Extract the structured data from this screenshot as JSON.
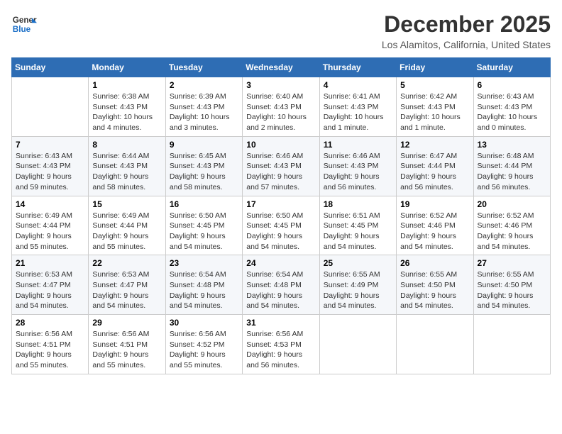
{
  "header": {
    "logo_line1": "General",
    "logo_line2": "Blue",
    "month": "December 2025",
    "location": "Los Alamitos, California, United States"
  },
  "weekdays": [
    "Sunday",
    "Monday",
    "Tuesday",
    "Wednesday",
    "Thursday",
    "Friday",
    "Saturday"
  ],
  "weeks": [
    [
      {
        "day": "",
        "info": ""
      },
      {
        "day": "1",
        "info": "Sunrise: 6:38 AM\nSunset: 4:43 PM\nDaylight: 10 hours\nand 4 minutes."
      },
      {
        "day": "2",
        "info": "Sunrise: 6:39 AM\nSunset: 4:43 PM\nDaylight: 10 hours\nand 3 minutes."
      },
      {
        "day": "3",
        "info": "Sunrise: 6:40 AM\nSunset: 4:43 PM\nDaylight: 10 hours\nand 2 minutes."
      },
      {
        "day": "4",
        "info": "Sunrise: 6:41 AM\nSunset: 4:43 PM\nDaylight: 10 hours\nand 1 minute."
      },
      {
        "day": "5",
        "info": "Sunrise: 6:42 AM\nSunset: 4:43 PM\nDaylight: 10 hours\nand 1 minute."
      },
      {
        "day": "6",
        "info": "Sunrise: 6:43 AM\nSunset: 4:43 PM\nDaylight: 10 hours\nand 0 minutes."
      }
    ],
    [
      {
        "day": "7",
        "info": "Sunrise: 6:43 AM\nSunset: 4:43 PM\nDaylight: 9 hours\nand 59 minutes."
      },
      {
        "day": "8",
        "info": "Sunrise: 6:44 AM\nSunset: 4:43 PM\nDaylight: 9 hours\nand 58 minutes."
      },
      {
        "day": "9",
        "info": "Sunrise: 6:45 AM\nSunset: 4:43 PM\nDaylight: 9 hours\nand 58 minutes."
      },
      {
        "day": "10",
        "info": "Sunrise: 6:46 AM\nSunset: 4:43 PM\nDaylight: 9 hours\nand 57 minutes."
      },
      {
        "day": "11",
        "info": "Sunrise: 6:46 AM\nSunset: 4:43 PM\nDaylight: 9 hours\nand 56 minutes."
      },
      {
        "day": "12",
        "info": "Sunrise: 6:47 AM\nSunset: 4:44 PM\nDaylight: 9 hours\nand 56 minutes."
      },
      {
        "day": "13",
        "info": "Sunrise: 6:48 AM\nSunset: 4:44 PM\nDaylight: 9 hours\nand 56 minutes."
      }
    ],
    [
      {
        "day": "14",
        "info": "Sunrise: 6:49 AM\nSunset: 4:44 PM\nDaylight: 9 hours\nand 55 minutes."
      },
      {
        "day": "15",
        "info": "Sunrise: 6:49 AM\nSunset: 4:44 PM\nDaylight: 9 hours\nand 55 minutes."
      },
      {
        "day": "16",
        "info": "Sunrise: 6:50 AM\nSunset: 4:45 PM\nDaylight: 9 hours\nand 54 minutes."
      },
      {
        "day": "17",
        "info": "Sunrise: 6:50 AM\nSunset: 4:45 PM\nDaylight: 9 hours\nand 54 minutes."
      },
      {
        "day": "18",
        "info": "Sunrise: 6:51 AM\nSunset: 4:45 PM\nDaylight: 9 hours\nand 54 minutes."
      },
      {
        "day": "19",
        "info": "Sunrise: 6:52 AM\nSunset: 4:46 PM\nDaylight: 9 hours\nand 54 minutes."
      },
      {
        "day": "20",
        "info": "Sunrise: 6:52 AM\nSunset: 4:46 PM\nDaylight: 9 hours\nand 54 minutes."
      }
    ],
    [
      {
        "day": "21",
        "info": "Sunrise: 6:53 AM\nSunset: 4:47 PM\nDaylight: 9 hours\nand 54 minutes."
      },
      {
        "day": "22",
        "info": "Sunrise: 6:53 AM\nSunset: 4:47 PM\nDaylight: 9 hours\nand 54 minutes."
      },
      {
        "day": "23",
        "info": "Sunrise: 6:54 AM\nSunset: 4:48 PM\nDaylight: 9 hours\nand 54 minutes."
      },
      {
        "day": "24",
        "info": "Sunrise: 6:54 AM\nSunset: 4:48 PM\nDaylight: 9 hours\nand 54 minutes."
      },
      {
        "day": "25",
        "info": "Sunrise: 6:55 AM\nSunset: 4:49 PM\nDaylight: 9 hours\nand 54 minutes."
      },
      {
        "day": "26",
        "info": "Sunrise: 6:55 AM\nSunset: 4:50 PM\nDaylight: 9 hours\nand 54 minutes."
      },
      {
        "day": "27",
        "info": "Sunrise: 6:55 AM\nSunset: 4:50 PM\nDaylight: 9 hours\nand 54 minutes."
      }
    ],
    [
      {
        "day": "28",
        "info": "Sunrise: 6:56 AM\nSunset: 4:51 PM\nDaylight: 9 hours\nand 55 minutes."
      },
      {
        "day": "29",
        "info": "Sunrise: 6:56 AM\nSunset: 4:51 PM\nDaylight: 9 hours\nand 55 minutes."
      },
      {
        "day": "30",
        "info": "Sunrise: 6:56 AM\nSunset: 4:52 PM\nDaylight: 9 hours\nand 55 minutes."
      },
      {
        "day": "31",
        "info": "Sunrise: 6:56 AM\nSunset: 4:53 PM\nDaylight: 9 hours\nand 56 minutes."
      },
      {
        "day": "",
        "info": ""
      },
      {
        "day": "",
        "info": ""
      },
      {
        "day": "",
        "info": ""
      }
    ]
  ]
}
